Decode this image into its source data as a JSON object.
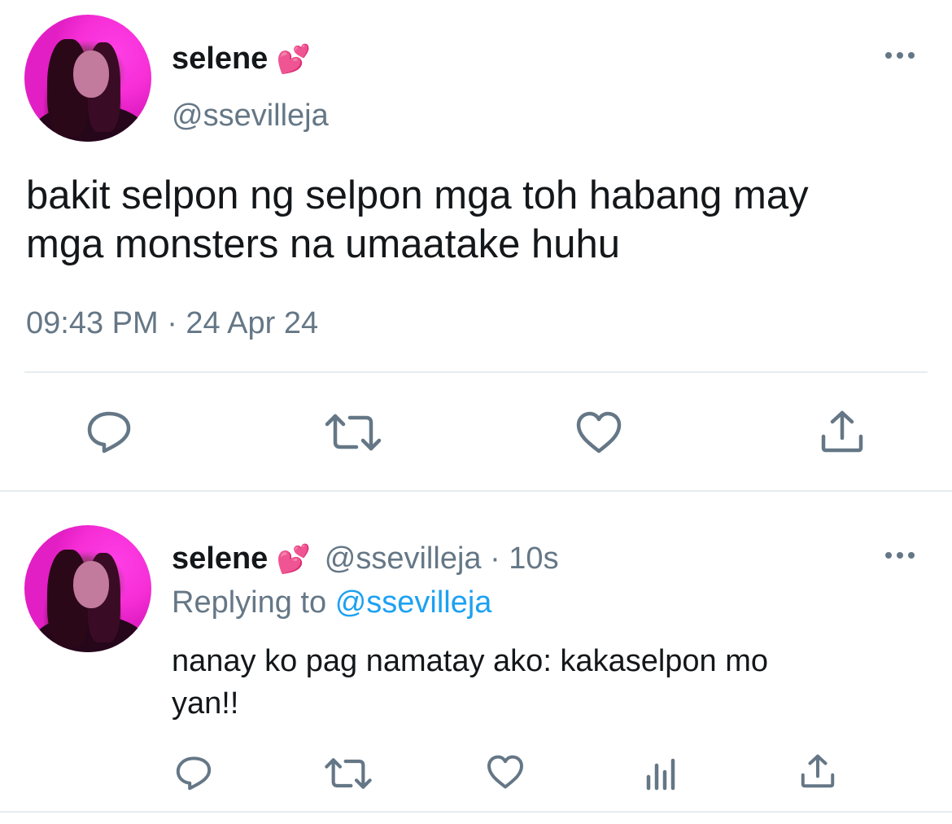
{
  "main_tweet": {
    "display_name": "selene",
    "name_emoji": "💕",
    "handle": "@ssevilleja",
    "text_line1": "bakit selpon ng selpon mga toh habang may",
    "text_line2": "mga monsters na umaatake huhu",
    "timestamp": "09:43 PM · 24 Apr 24"
  },
  "reply_tweet": {
    "display_name": "selene",
    "name_emoji": "💕",
    "handle_time": "@ssevilleja · 10s",
    "replying_prefix": "Replying to",
    "replying_handle": "@ssevilleja",
    "text_line1": "nanay ko pag namatay ako: kakaselpon mo",
    "text_line2": "yan!!"
  },
  "icons": {
    "more": "more-icon",
    "reply": "reply-icon",
    "retweet": "retweet-icon",
    "like": "heart-icon",
    "share": "share-icon",
    "analytics": "analytics-icon"
  },
  "colors": {
    "icon_gray": "#657786",
    "link_blue": "#1da1f2",
    "divider": "#e6ecf0"
  }
}
